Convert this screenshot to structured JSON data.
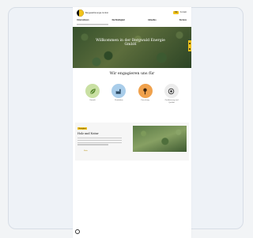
{
  "header": {
    "brand": "Bergwald Energie GmbH",
    "language_button": "DE",
    "contact_link": "Kontakt",
    "nav": [
      "Unternehmen",
      "Nachhaltigkeit",
      "Aktuelles",
      "Karriere"
    ]
  },
  "hero": {
    "title": "Willkommen in der Bergwald Energie GmbH"
  },
  "commitment": {
    "title": "Wir engagieren uns für",
    "items": [
      {
        "label": "Umwelt",
        "icon": "leaf-icon",
        "color": "#c9e0a3"
      },
      {
        "label": "Produktion",
        "icon": "factory-icon",
        "color": "#a9cdea"
      },
      {
        "label": "Forschung",
        "icon": "pin-icon",
        "color": "#f0a14c"
      },
      {
        "label": "Zertifizierung und Qualität",
        "icon": "globe-icon",
        "color": "#ececec"
      }
    ]
  },
  "news": {
    "tag": "Neuigkeit",
    "heading": "Holz und Natur",
    "link": "Mehr"
  },
  "colors": {
    "accent": "#f1c21b"
  }
}
